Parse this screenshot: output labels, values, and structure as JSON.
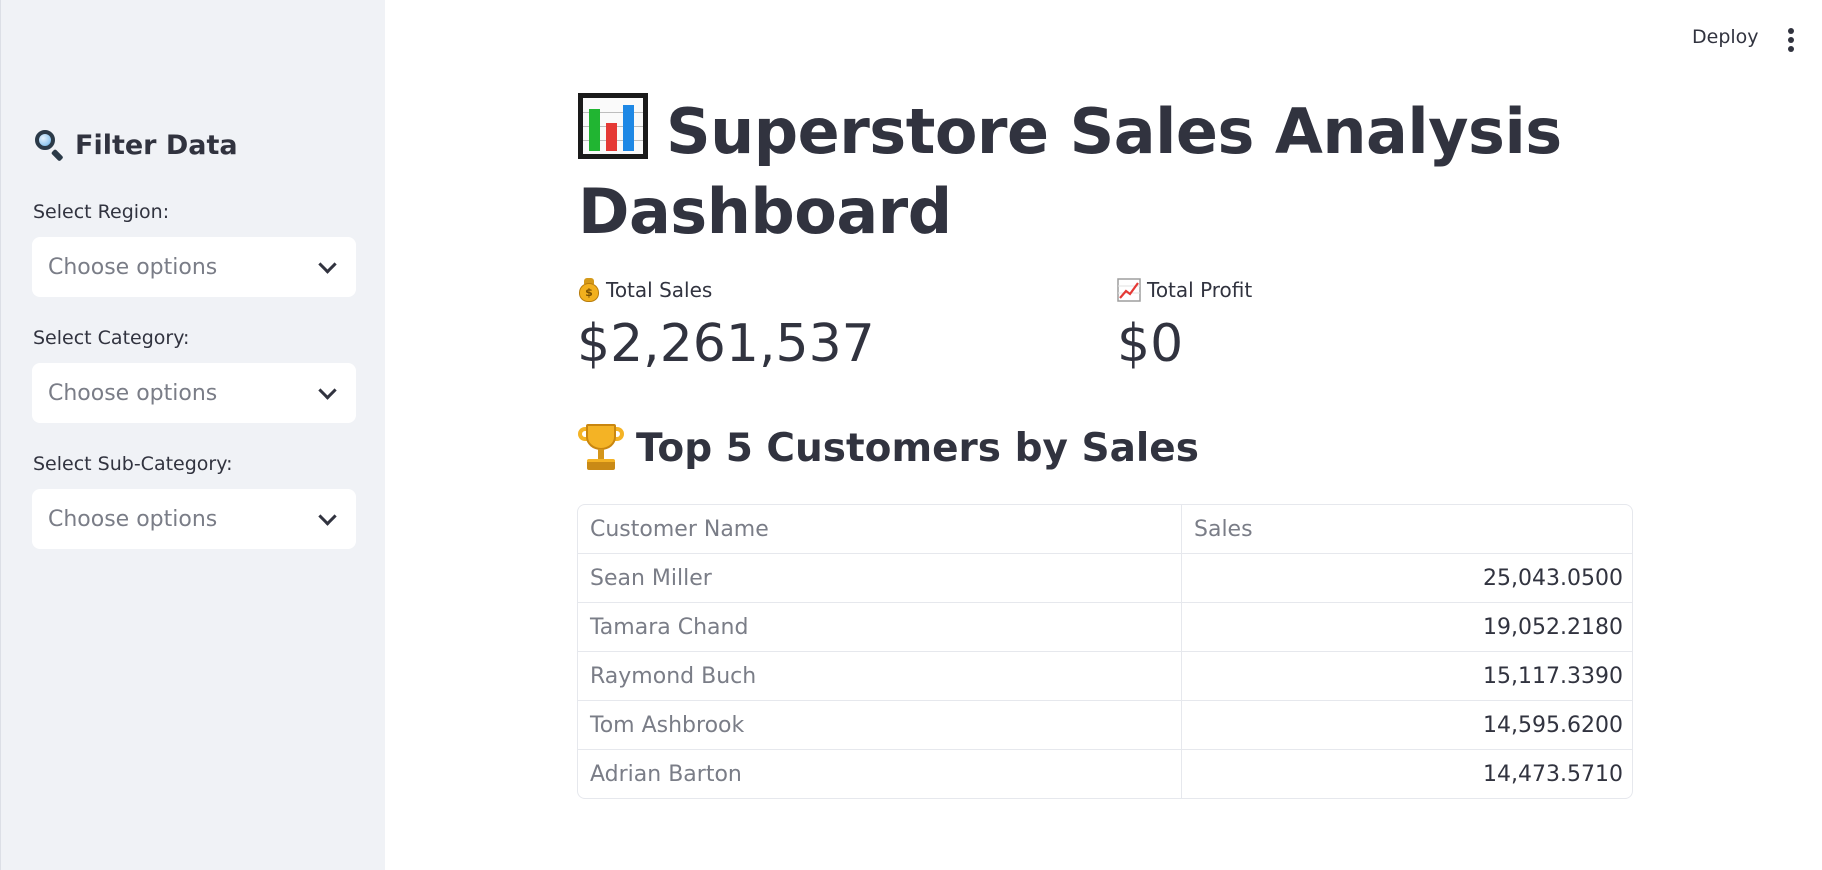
{
  "app": {
    "deploy_label": "Deploy",
    "menu_icon": "kebab-menu-icon"
  },
  "sidebar": {
    "header": {
      "icon": "magnifying-glass-icon",
      "title": "Filter Data"
    },
    "filters": [
      {
        "label": "Select Region:",
        "placeholder": "Choose options"
      },
      {
        "label": "Select Category:",
        "placeholder": "Choose options"
      },
      {
        "label": "Select Sub-Category:",
        "placeholder": "Choose options"
      }
    ]
  },
  "main": {
    "title_icon": "bar-chart-icon",
    "title": "Superstore Sales Analysis Dashboard",
    "metrics": [
      {
        "icon": "money-bag-icon",
        "label": "Total Sales",
        "value": "$2,261,537"
      },
      {
        "icon": "chart-increasing-icon",
        "label": "Total Profit",
        "value": "$0"
      }
    ],
    "top_customers": {
      "icon": "trophy-icon",
      "title": "Top 5 Customers by Sales",
      "columns": [
        "Customer Name",
        "Sales"
      ],
      "rows": [
        {
          "name": "Sean Miller",
          "sales": "25,043.0500"
        },
        {
          "name": "Tamara Chand",
          "sales": "19,052.2180"
        },
        {
          "name": "Raymond Buch",
          "sales": "15,117.3390"
        },
        {
          "name": "Tom Ashbrook",
          "sales": "14,595.6200"
        },
        {
          "name": "Adrian Barton",
          "sales": "14,473.5710"
        }
      ]
    }
  },
  "colors": {
    "sidebar_bg": "#f0f2f6",
    "text": "#31333f",
    "muted_text": "#7a7d87",
    "border": "#e6e8ed"
  }
}
